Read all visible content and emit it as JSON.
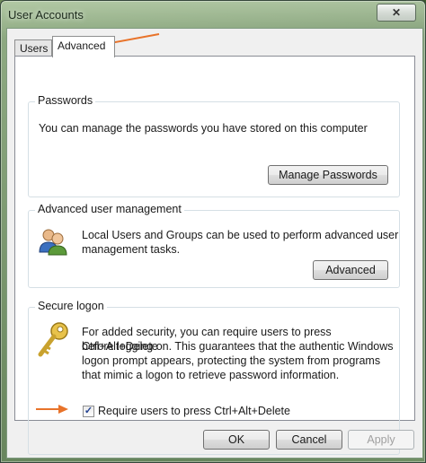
{
  "window": {
    "title": "User Accounts",
    "close_glyph": "✕"
  },
  "tabs": [
    {
      "label": "Users",
      "selected": false
    },
    {
      "label": "Advanced",
      "selected": true
    }
  ],
  "passwords": {
    "title": "Passwords",
    "text": "You can manage the passwords you have stored on this computer",
    "button": "Manage Passwords"
  },
  "advanced_management": {
    "title": "Advanced user management",
    "text_line1": "Local Users and Groups can be used to perform advanced user",
    "text_line2": "management tasks.",
    "button": "Advanced",
    "icon": "users-group-icon"
  },
  "secure_logon": {
    "title": "Secure logon",
    "text_line1": "For added security, you can require users to press Ctrl+Alt+Delete",
    "text_line2": "before logging on. This guarantees that the authentic Windows",
    "text_line3": "logon prompt appears, protecting the system from programs",
    "text_line4": "that mimic a logon to retrieve password information.",
    "checkbox_label": "Require users to press Ctrl+Alt+Delete",
    "checkbox_checked": true,
    "icon": "key-icon"
  },
  "footer": {
    "ok": "OK",
    "cancel": "Cancel",
    "apply": "Apply",
    "apply_enabled": false
  },
  "annotations": {
    "arrow_color": "#e8732a"
  }
}
